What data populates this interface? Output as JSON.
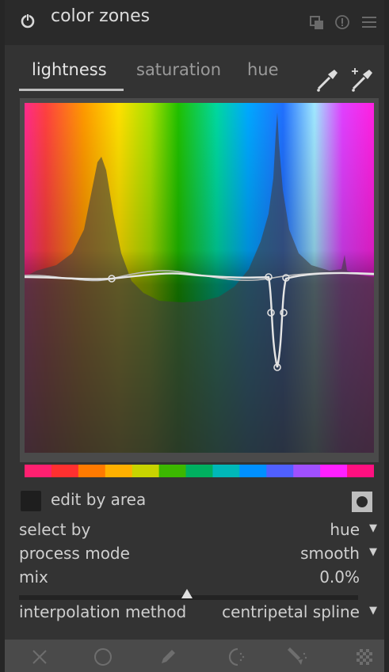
{
  "header": {
    "title": "color zones",
    "icons": [
      "power-icon",
      "multi-instance-icon",
      "reset-icon",
      "presets-menu-icon"
    ]
  },
  "tabs": [
    {
      "label": "lightness",
      "active": true
    },
    {
      "label": "saturation",
      "active": false
    },
    {
      "label": "hue",
      "active": false
    }
  ],
  "pickers": [
    "color-picker-icon",
    "color-picker-add-icon"
  ],
  "graph": {
    "curve_node_count": 7,
    "colorbar_colors": [
      "#ff2070",
      "#ff3030",
      "#ff7a00",
      "#ffb000",
      "#c8d400",
      "#3cb800",
      "#00b060",
      "#00b8b8",
      "#0090ff",
      "#5060ff",
      "#a050ff",
      "#ff20ff",
      "#ff1080"
    ]
  },
  "edit_by_area": {
    "label": "edit by area",
    "checked": false
  },
  "select_by": {
    "label": "select by",
    "value": "hue"
  },
  "process_mode": {
    "label": "process mode",
    "value": "smooth"
  },
  "mix": {
    "label": "mix",
    "value": "0.0%"
  },
  "interpolation": {
    "label": "interpolation method",
    "value": "centripetal spline"
  },
  "bottom_icons": [
    "close-icon",
    "circle-shape-icon",
    "pencil-shape-icon",
    "gradient-shape-icon",
    "brush-shape-icon",
    "checkerboard-icon"
  ]
}
